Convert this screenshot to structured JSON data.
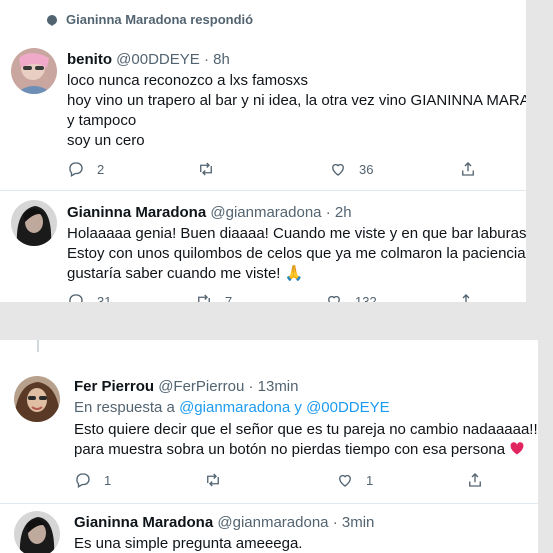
{
  "top_header": {
    "text": "Gianinna Maradona respondió"
  },
  "tweets": [
    {
      "name": "benito",
      "handle": "@00DDEYE",
      "time": "· 8h",
      "lines": [
        "loco nunca reconozco a lxs famosxs",
        "hoy vino un trapero al bar y ni idea, la otra vez vino GIANINNA MARADONA",
        "y tampoco",
        "soy un cero"
      ],
      "reply_count": "2",
      "retweet_count": "",
      "like_count": "36"
    },
    {
      "name": "Gianinna Maradona",
      "handle": "@gianmaradona",
      "time": "· 2h",
      "lines": [
        "Holaaaaa genia! Buen diaaaa! Cuando me viste y en que bar laburas???",
        "Estoy con unos quilombos de celos que ya me colmaron la paciencia y me",
        "gustaría saber cuando me viste! 🙏"
      ],
      "reply_count": "31",
      "retweet_count": "7",
      "like_count": "132"
    },
    {
      "name": "Fer Pierrou",
      "handle": "@FerPierrou",
      "time": "· 13min",
      "reply_prefix": "En respuesta a",
      "reply_link1": "@gianmaradona",
      "reply_and": "y",
      "reply_link2": "@00DDEYE",
      "lines": [
        "Esto quiere decir que el señor que es tu pareja no cambio nadaaaaa!!!!(",
        "para muestra sobra un botón no pierdas tiempo con esa persona"
      ],
      "reply_count": "1",
      "retweet_count": "",
      "like_count": "1"
    },
    {
      "name": "Gianinna Maradona",
      "handle": "@gianmaradona",
      "time": "· 3min",
      "lines": [
        "Es una simple pregunta ameeega."
      ]
    }
  ],
  "icons": {
    "replied": "speech-bubble-icon",
    "reply": "reply-icon",
    "retweet": "retweet-icon",
    "like": "heart-icon",
    "share": "share-icon",
    "emoji_heart": "red-heart-emoji"
  },
  "colors": {
    "link": "#1d9bf0",
    "muted": "#536471",
    "heart": "#e0245e"
  }
}
